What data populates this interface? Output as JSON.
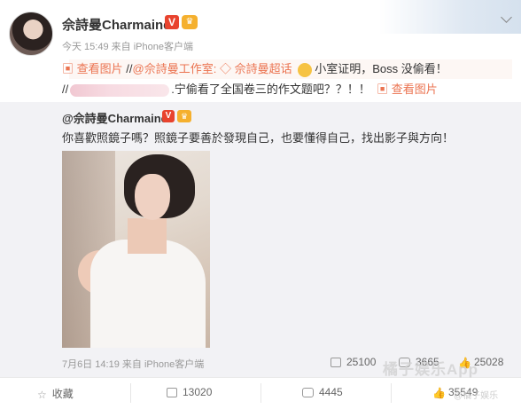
{
  "post": {
    "author": "佘詩曼Charmaine",
    "verified_badge": "V",
    "time": "今天 15:49",
    "source": "来自 iPhone客户端",
    "line1": {
      "view_image": "查看图片",
      "slash1": "//",
      "mention_studio": "@佘詩曼工作室:",
      "super_topic": "佘詩曼超话",
      "text": "小室证明，Boss 没偷看！"
    },
    "line2": {
      "slash": "//",
      "text": ".宁偷看了全国卷三的作文题吧？？！！",
      "view_image": "查看图片"
    }
  },
  "forward": {
    "author": "@佘詩曼Charmaine",
    "badge": "V",
    "text": "你喜歡照鏡子嗎？照鏡子要善於發現自己，也要懂得自己，找出影子與方向！",
    "date": "7月6日 14:19",
    "source": "来自 iPhone客户端",
    "reposts": "25100",
    "comments": "3665",
    "likes": "25028"
  },
  "actions": {
    "collect": "收藏",
    "repost_count": "13020",
    "comment_count": "4445",
    "like_count": "35549"
  },
  "watermark": {
    "brand": "橘子娱乐App",
    "sub": "@橘子娱乐"
  },
  "icons": [
    "star-icon",
    "repost-icon",
    "comment-icon",
    "like-icon",
    "chevron-down-icon",
    "image-icon"
  ],
  "colors": {
    "link": "#eb7350",
    "forward_bg": "#f2f2f5",
    "verified": "#e8432e"
  }
}
